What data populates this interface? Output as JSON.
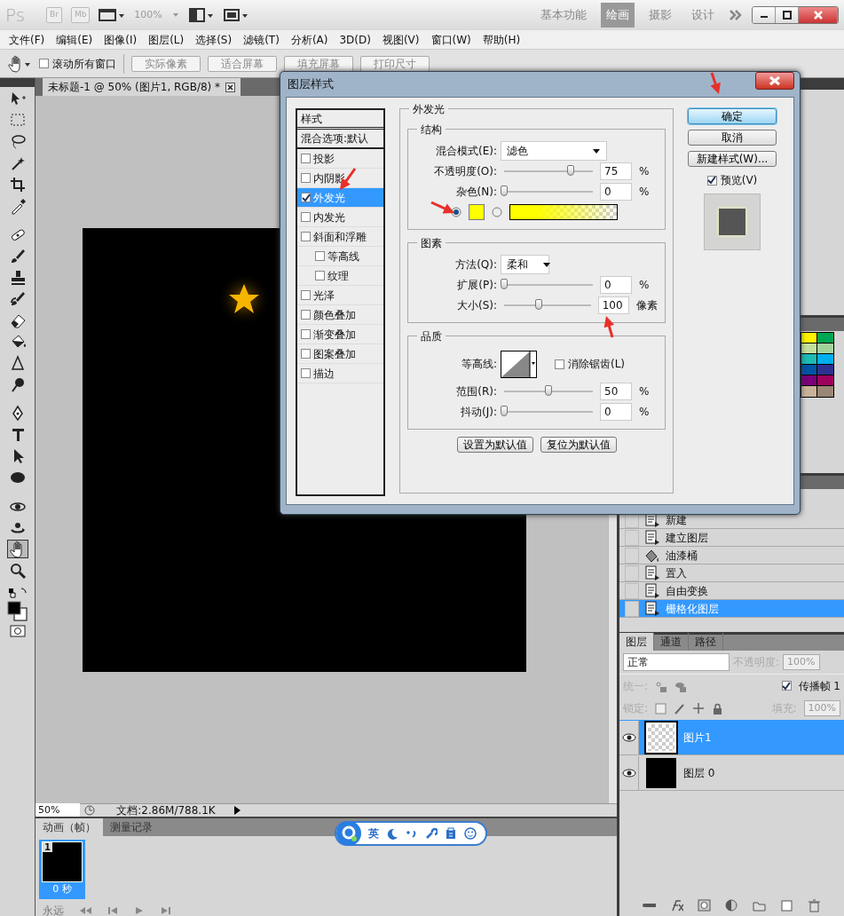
{
  "app": {
    "logo": "Ps",
    "bridge": "Br",
    "mini_bridge": "Mb",
    "zoom": "100%",
    "workspaces": [
      {
        "label": "基本功能",
        "selected": false
      },
      {
        "label": "绘画",
        "selected": true
      },
      {
        "label": "摄影",
        "selected": false
      },
      {
        "label": "设计",
        "selected": false
      }
    ]
  },
  "menu": [
    "文件(F)",
    "编辑(E)",
    "图像(I)",
    "图层(L)",
    "选择(S)",
    "滤镜(T)",
    "分析(A)",
    "3D(D)",
    "视图(V)",
    "窗口(W)",
    "帮助(H)"
  ],
  "options": {
    "scroll_all": {
      "label": "滚动所有窗口",
      "checked": false
    },
    "buttons": [
      "实际像素",
      "适合屏幕",
      "填充屏幕",
      "打印尺寸"
    ]
  },
  "tools": [
    {
      "selected": false
    },
    {
      "selected": false
    },
    {
      "selected": false
    },
    {
      "selected": false
    },
    {
      "selected": false
    },
    {
      "selected": false
    },
    {
      "selected": false
    },
    {
      "selected": false
    },
    {
      "selected": false
    },
    {
      "selected": false
    },
    {
      "selected": false
    },
    {
      "selected": false
    },
    {
      "selected": false
    },
    {
      "selected": false
    },
    {
      "selected": false
    },
    {
      "selected": false
    },
    {
      "selected": false
    },
    {
      "selected": false
    },
    {
      "selected": false
    },
    {
      "selected": false
    },
    {
      "selected": true
    },
    {
      "selected": false
    }
  ],
  "document": {
    "tab": "未标题-1 @ 50% (图片1, RGB/8) *",
    "zoom": "50%",
    "doc_info": "文档:2.86M/788.1K"
  },
  "animation": {
    "tabs": [
      {
        "label": "动画（帧）",
        "selected": true
      },
      {
        "label": "测量记录",
        "selected": false
      }
    ],
    "frames": [
      {
        "number": "1",
        "delay": "0 秒",
        "selected": true
      }
    ],
    "loop": "永远"
  },
  "ime": {
    "mode": "英"
  },
  "swatches": [
    {
      "color": "#fff200"
    },
    {
      "color": "#00a651"
    },
    {
      "color": "#c4df9b"
    },
    {
      "color": "#a3d39c"
    },
    {
      "color": "#1cbbb4"
    },
    {
      "color": "#00aeef"
    },
    {
      "color": "#0054a6"
    },
    {
      "color": "#2e3192"
    },
    {
      "color": "#790077"
    },
    {
      "color": "#9e005d"
    },
    {
      "color": "#c7b299"
    },
    {
      "color": "#998675"
    }
  ],
  "history": [
    {
      "label": "新建",
      "kind": "command",
      "selected": false
    },
    {
      "label": "建立图层",
      "kind": "command",
      "selected": false
    },
    {
      "label": "油漆桶",
      "kind": "fill",
      "selected": false
    },
    {
      "label": "置入",
      "kind": "command",
      "selected": false
    },
    {
      "label": "自由变换",
      "kind": "command",
      "selected": false
    },
    {
      "label": "栅格化图层",
      "kind": "command",
      "selected": true
    }
  ],
  "layers_panel": {
    "tabs": [
      {
        "label": "图层",
        "selected": true
      },
      {
        "label": "通道",
        "selected": false
      },
      {
        "label": "路径",
        "selected": false
      }
    ],
    "blend_mode": "正常",
    "opacity_label": "不透明度:",
    "opacity": "100%",
    "unify_label": "统一:",
    "propagate": {
      "label": "传播帧 1",
      "checked": true
    },
    "lock_label": "锁定:",
    "fill_label": "填充:",
    "fill": "100%",
    "layers": [
      {
        "name": "图片1",
        "visible": true,
        "selected": true,
        "kind": "transparent"
      },
      {
        "name": "图层 0",
        "visible": true,
        "selected": false,
        "kind": "black"
      }
    ]
  },
  "dialog": {
    "title": "图层样式",
    "styles_header": "样式",
    "blend_options": "混合选项:默认",
    "styles": [
      {
        "label": "投影",
        "checked": false,
        "selected": false
      },
      {
        "label": "内阴影",
        "checked": false,
        "selected": false
      },
      {
        "label": "外发光",
        "checked": true,
        "selected": true
      },
      {
        "label": "内发光",
        "checked": false,
        "selected": false
      },
      {
        "label": "斜面和浮雕",
        "checked": false,
        "selected": false,
        "children": [
          {
            "label": "等高线",
            "checked": false,
            "selected": false
          },
          {
            "label": "纹理",
            "checked": false,
            "selected": false
          }
        ]
      },
      {
        "label": "光泽",
        "checked": false,
        "selected": false
      },
      {
        "label": "颜色叠加",
        "checked": false,
        "selected": false
      },
      {
        "label": "渐变叠加",
        "checked": false,
        "selected": false
      },
      {
        "label": "图案叠加",
        "checked": false,
        "selected": false
      },
      {
        "label": "描边",
        "checked": false,
        "selected": false
      }
    ],
    "section_title": "外发光",
    "structure": {
      "title": "结构",
      "blend_mode_label": "混合模式(E):",
      "blend_mode": "滤色",
      "sliders": [
        {
          "label": "不透明度(O):",
          "level": 0.75,
          "value": "75",
          "unit": "%"
        },
        {
          "label": "杂色(N):",
          "level": 0,
          "value": "0",
          "unit": "%"
        }
      ],
      "fills": [
        {
          "kind": "solid",
          "selected": true,
          "color": "#ffff00"
        },
        {
          "kind": "gradient",
          "selected": false,
          "color": "#ffff00"
        }
      ]
    },
    "elements": {
      "title": "图素",
      "technique_label": "方法(Q):",
      "technique": "柔和",
      "sliders": [
        {
          "label": "扩展(P):",
          "level": 0,
          "value": "0",
          "unit": "%"
        },
        {
          "label": "大小(S):",
          "level": 0.4,
          "value": "100",
          "unit": "像素"
        }
      ]
    },
    "quality": {
      "title": "品质",
      "contour_label": "等高线:",
      "anti_alias": {
        "label": "消除锯齿(L)",
        "checked": false
      },
      "sliders": [
        {
          "label": "范围(R):",
          "level": 0.5,
          "value": "50",
          "unit": "%"
        },
        {
          "label": "抖动(J):",
          "level": 0,
          "value": "0",
          "unit": "%"
        }
      ]
    },
    "defaults": [
      "设置为默认值",
      "复位为默认值"
    ],
    "actions": [
      {
        "label": "确定",
        "default": true
      },
      {
        "label": "取消",
        "default": false
      },
      {
        "label": "新建样式(W)...",
        "default": false
      }
    ],
    "preview": {
      "label": "预览(V)",
      "checked": true
    }
  }
}
